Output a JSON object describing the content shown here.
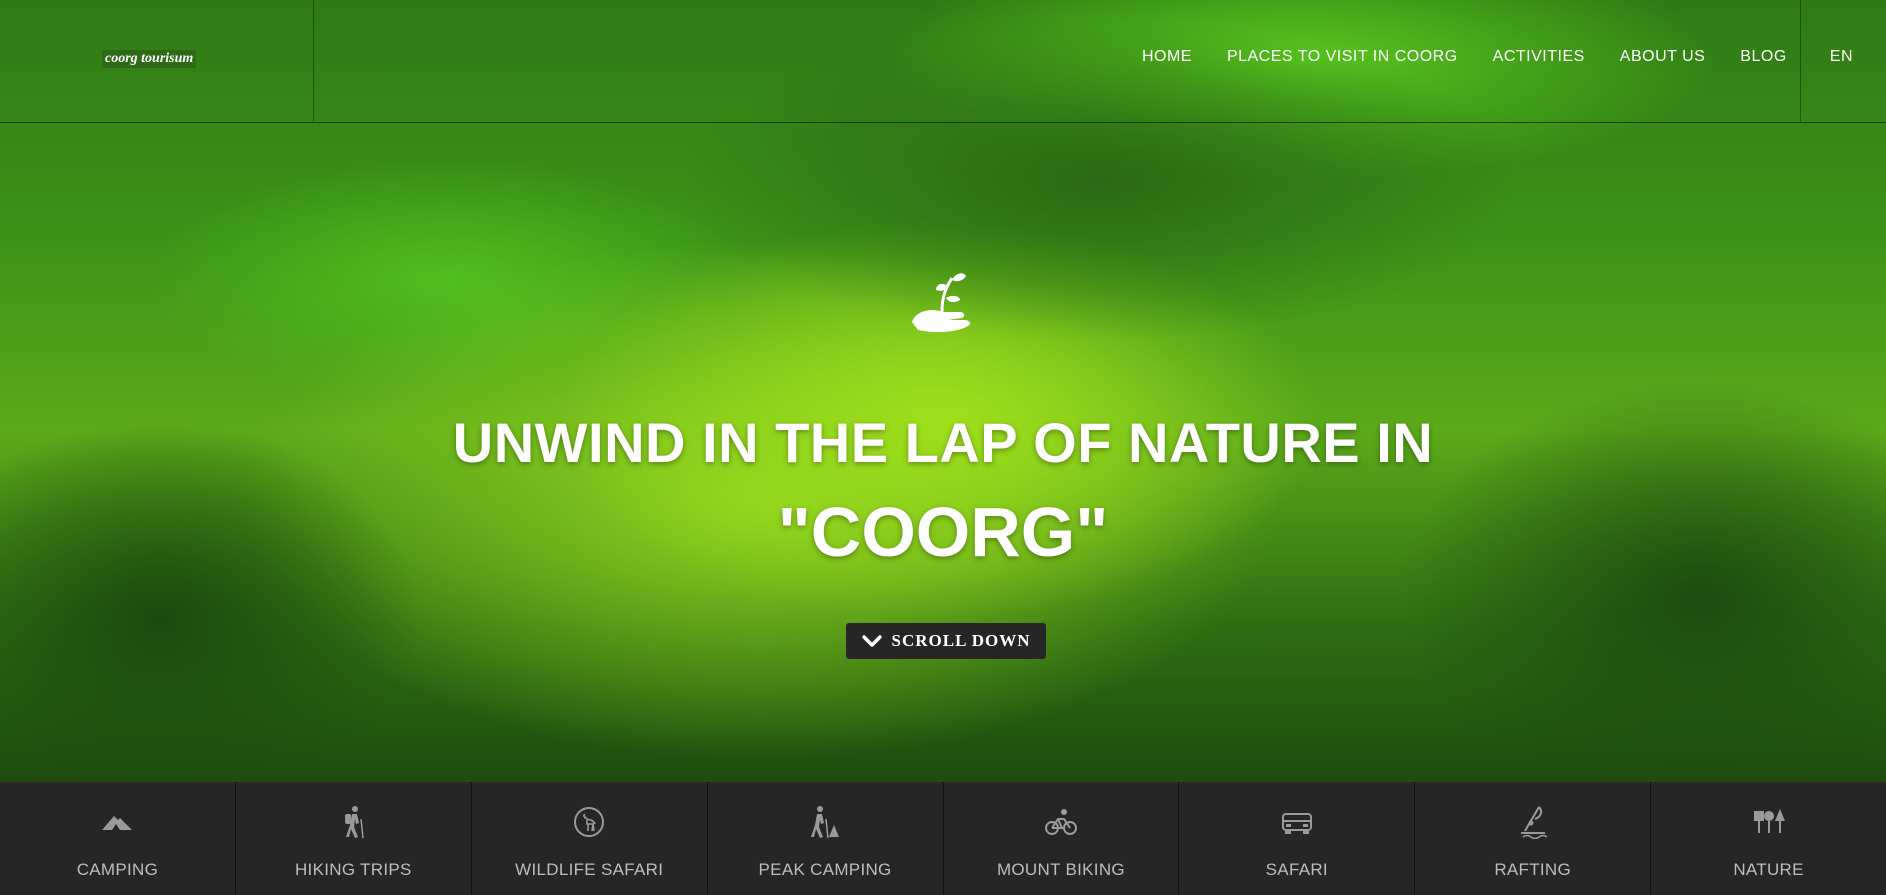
{
  "header": {
    "logo_text": "coorg tourisum",
    "nav": [
      {
        "label": "HOME"
      },
      {
        "label": "PLACES TO VISIT IN COORG"
      },
      {
        "label": "ACTIVITIES"
      },
      {
        "label": "ABOUT US"
      },
      {
        "label": "BLOG"
      }
    ],
    "language": "EN"
  },
  "hero": {
    "icon": "hand-sprout-icon",
    "headline_line1": "UNWIND IN THE LAP OF NATURE IN",
    "headline_line2": "\"COORG\"",
    "scroll_label": "SCROLL DOWN",
    "scroll_icon": "chevron-down-icon"
  },
  "categories": [
    {
      "label": "CAMPING",
      "icon": "tent-icon"
    },
    {
      "label": "HIKING TRIPS",
      "icon": "hiker-icon"
    },
    {
      "label": "WILDLIFE SAFARI",
      "icon": "deer-icon"
    },
    {
      "label": "PEAK CAMPING",
      "icon": "peak-hiker-icon"
    },
    {
      "label": "MOUNT BIKING",
      "icon": "cyclist-icon"
    },
    {
      "label": "SAFARI",
      "icon": "jeep-icon"
    },
    {
      "label": "RAFTING",
      "icon": "rafting-icon"
    },
    {
      "label": "NATURE",
      "icon": "trees-icon"
    }
  ],
  "colors": {
    "strip_bg": "#262626",
    "label_gray": "#bdbdbd",
    "hero_green": "#5caa1a"
  }
}
